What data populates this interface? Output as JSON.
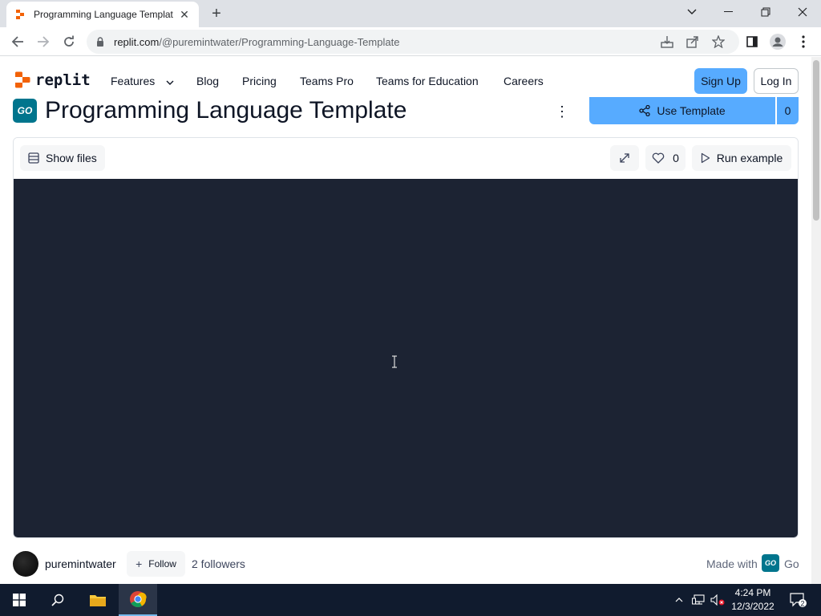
{
  "browser": {
    "tab_title": "Programming Language Templat",
    "url_host": "replit.com",
    "url_path": "/@puremintwater/Programming-Language-Template"
  },
  "site_nav": {
    "logo_text": "replit",
    "links": [
      "Features",
      "Blog",
      "Pricing",
      "Teams Pro",
      "Teams for Education",
      "Careers"
    ],
    "sign_up": "Sign Up",
    "log_in": "Log In"
  },
  "repl": {
    "language_badge": "GO",
    "title": "Programming Language Template",
    "use_template_label": "Use Template",
    "fork_count": "0",
    "show_files_label": "Show files",
    "like_count": "0",
    "run_label": "Run example"
  },
  "author": {
    "name": "puremintwater",
    "follow_label": "Follow",
    "followers": "2 followers",
    "made_with_label": "Made with",
    "made_with_badge": "GO",
    "language": "Go"
  },
  "taskbar": {
    "time": "4:24 PM",
    "date": "12/3/2022",
    "notification_count": "2"
  },
  "colors": {
    "accent": "#57abff",
    "console_bg": "#1c2333",
    "go_badge": "#00758d",
    "taskbar": "#101b2e"
  }
}
